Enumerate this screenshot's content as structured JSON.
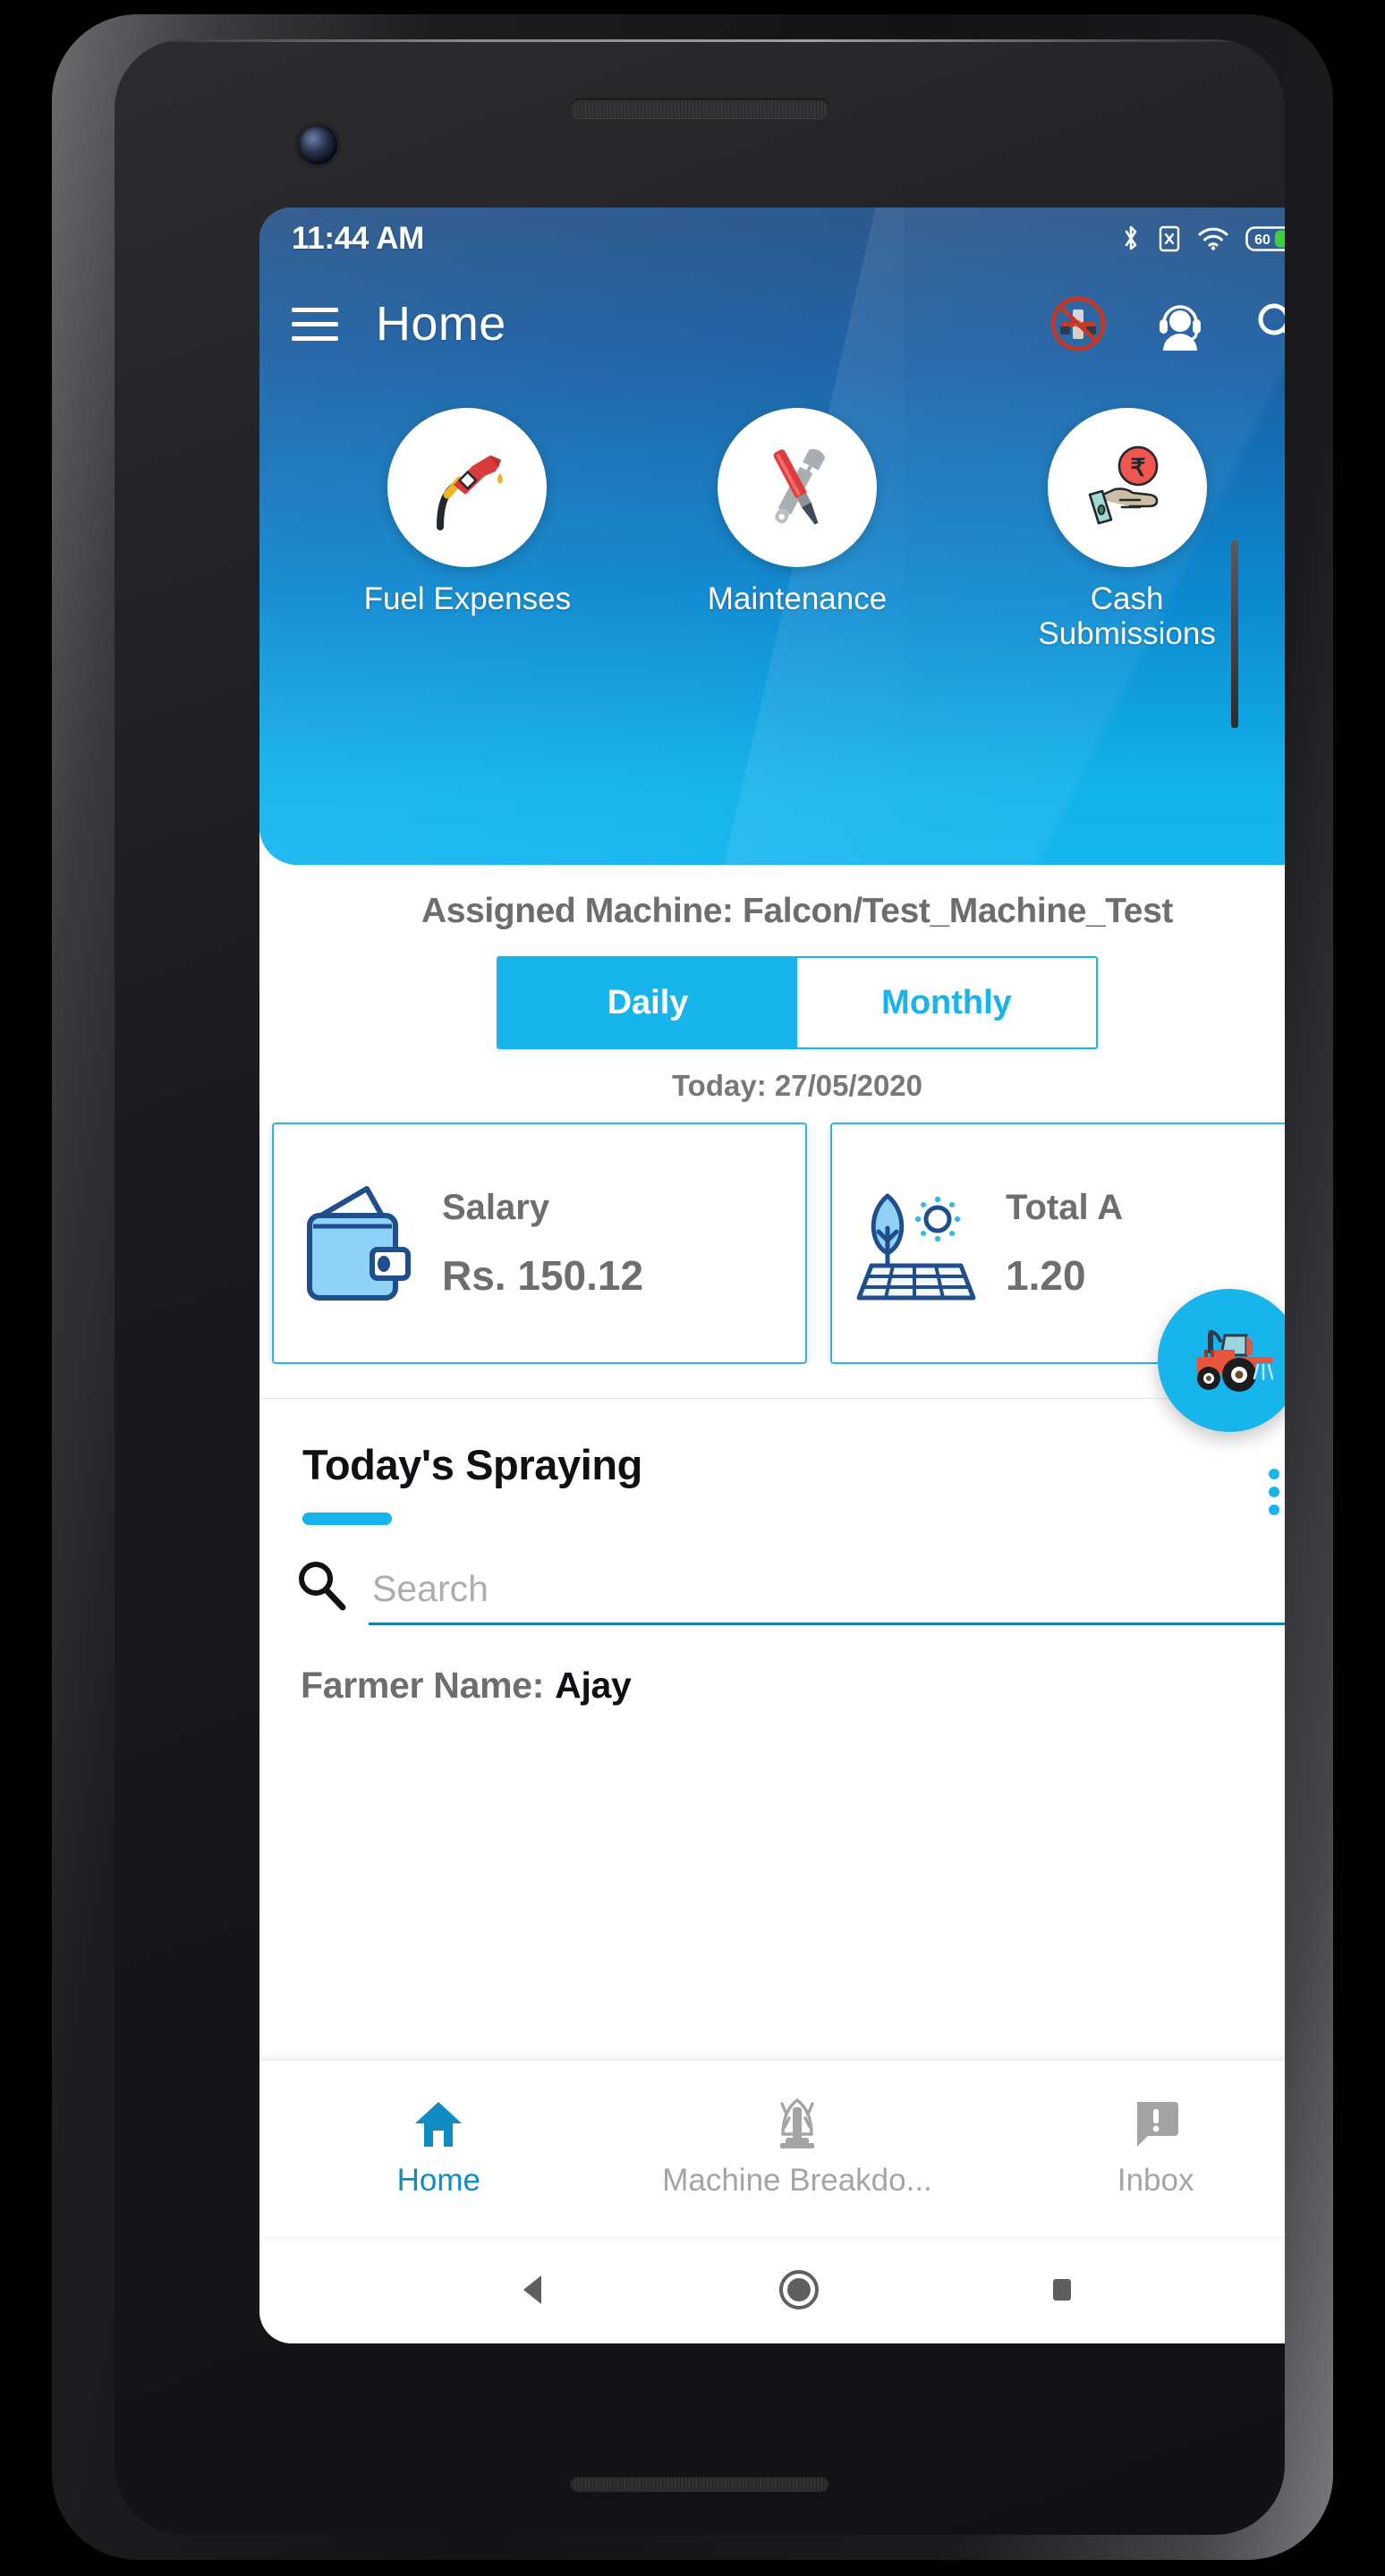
{
  "status_bar": {
    "time": "11:44 AM",
    "icons": [
      "bluetooth-icon",
      "sim-card-off-icon",
      "wifi-icon",
      "battery-icon"
    ],
    "battery_level": "60"
  },
  "app_bar": {
    "menu_icon": "hamburger-menu-icon",
    "title": "Home",
    "actions": [
      {
        "icon": "no-drone-icon"
      },
      {
        "icon": "support-headset-icon"
      },
      {
        "icon": "search-icon"
      }
    ]
  },
  "quick_actions": [
    {
      "label": "Fuel Expenses",
      "icon": "fuel-pump-icon"
    },
    {
      "label": "Maintenance",
      "icon": "tools-wrench-screwdriver-icon"
    },
    {
      "label": "Cash Submissions",
      "icon": "hand-rupee-coin-icon"
    }
  ],
  "assigned_machine": "Assigned Machine: Falcon/Test_Machine_Test",
  "period_tabs": [
    {
      "label": "Daily",
      "active": true
    },
    {
      "label": "Monthly",
      "active": false
    }
  ],
  "today_date": "Today: 27/05/2020",
  "stats": [
    {
      "title": "Salary",
      "value": "Rs. 150.12",
      "icon": "wallet-icon"
    },
    {
      "title": "Total A",
      "value": "1.20",
      "icon": "tree-solar-panel-icon"
    }
  ],
  "spraying": {
    "section_title": "Today's Spraying",
    "search_placeholder": "Search",
    "search_value": "",
    "search_icon": "search-icon",
    "fab_icon": "tractor-sprayer-icon",
    "overflow_icon": "more-vertical-icon",
    "rows": [
      {
        "label": "Farmer Name:",
        "value": "Ajay"
      }
    ]
  },
  "bottom_nav": [
    {
      "label": "Home",
      "icon": "home-icon",
      "active": true
    },
    {
      "label": "Machine Breakdo...",
      "icon": "machine-icon",
      "active": false
    },
    {
      "label": "Inbox",
      "icon": "message-alert-icon",
      "active": false
    }
  ],
  "android_nav": [
    {
      "icon": "back-triangle-icon"
    },
    {
      "icon": "home-circle-icon"
    },
    {
      "icon": "recents-square-icon"
    }
  ],
  "colors": {
    "accent": "#18b4ec",
    "header_top": "#265389",
    "header_bottom": "#15b6ef",
    "nav_active": "#108cc4",
    "text_gray": "#6e6e6e"
  }
}
